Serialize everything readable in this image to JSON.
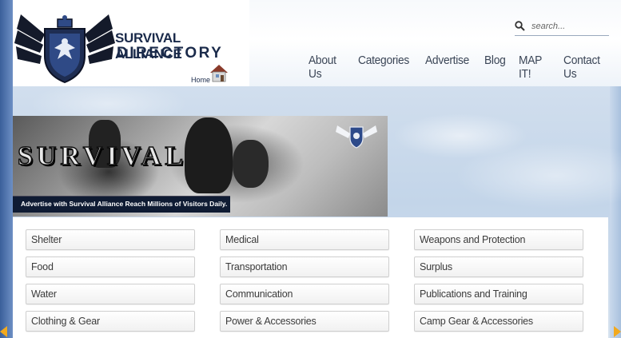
{
  "logo": {
    "title_line1": "SURVIVAL ALLIANCE",
    "title_line2": "DIRECTORY",
    "home_label": "Home"
  },
  "search": {
    "placeholder": "search..."
  },
  "nav": {
    "items": [
      "About Us",
      "Categories",
      "Advertise",
      "Blog",
      "MAP IT!",
      "Contact Us"
    ]
  },
  "banner": {
    "title": "SURVIVAL",
    "caption": "Advertise with Survival Alliance Reach Millions of Visitors Daily."
  },
  "categories": {
    "col1": [
      "Shelter",
      "Food",
      "Water",
      "Clothing & Gear"
    ],
    "col2": [
      "Medical",
      "Transportation",
      "Communication",
      "Power & Accessories"
    ],
    "col3": [
      "Weapons and Protection",
      "Surplus",
      "Publications and Training",
      "Camp Gear & Accessories"
    ]
  },
  "colors": {
    "brand_navy": "#1a2a4a",
    "nav_text": "#3a4556",
    "arrow_accent": "#f2a91e"
  }
}
